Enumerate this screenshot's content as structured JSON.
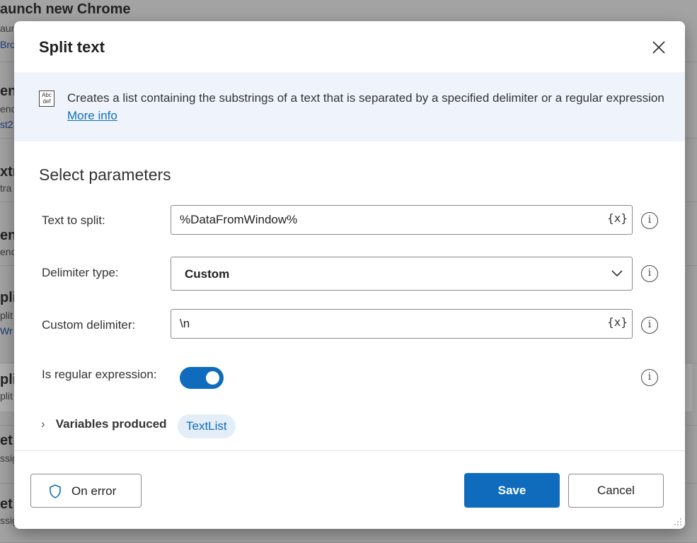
{
  "background": {
    "items": [
      {
        "title": "aunch new Chrome",
        "sub": "aun",
        "link": "Bro"
      },
      {
        "title": "en",
        "sub": "enc",
        "link": "st2"
      },
      {
        "title": "xtr",
        "sub": "tra",
        "link": ""
      },
      {
        "title": "en",
        "sub": "enc",
        "link": ""
      },
      {
        "title": "pli",
        "sub": "plit",
        "link": "Wr"
      },
      {
        "title": "pli",
        "sub": "plit",
        "link": ""
      },
      {
        "title": "et",
        "sub": "ssig",
        "link": ""
      },
      {
        "title": "et",
        "sub": "ssig",
        "link": ""
      }
    ]
  },
  "dialog": {
    "title": "Split text",
    "close_icon": "close-icon",
    "banner": {
      "icon": "abc-def-icon",
      "icon_text": "Abc def",
      "text": "Creates a list containing the substrings of a text that is separated by a specified delimiter or a regular expression",
      "link": "More info"
    },
    "section_title": "Select parameters",
    "fields": {
      "text_to_split": {
        "label": "Text to split:",
        "value": "%DataFromWindow%",
        "var_button": "{x}"
      },
      "delimiter_type": {
        "label": "Delimiter type:",
        "value": "Custom"
      },
      "custom_delimiter": {
        "label": "Custom delimiter:",
        "value": "\\n",
        "var_button": "{x}"
      },
      "is_regex": {
        "label": "Is regular expression:",
        "enabled": true
      }
    },
    "variables": {
      "label": "Variables produced",
      "chip": "TextList"
    },
    "footer": {
      "on_error": "On error",
      "save": "Save",
      "cancel": "Cancel"
    },
    "colors": {
      "accent": "#0f6cbd",
      "banner_bg": "#eff4fc",
      "chip_bg": "#e3eef9"
    }
  }
}
